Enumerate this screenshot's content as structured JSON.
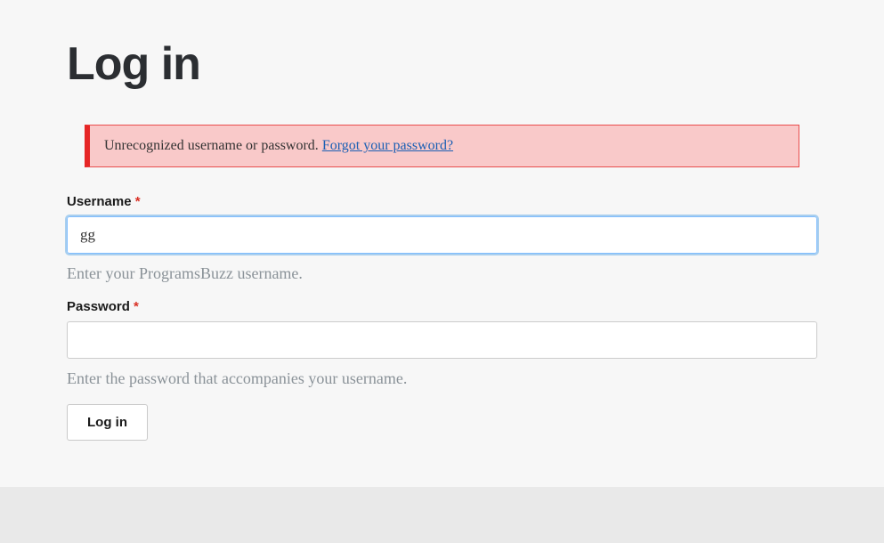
{
  "page": {
    "title": "Log in"
  },
  "alert": {
    "message": "Unrecognized username or password. ",
    "link_text": "Forgot your password?"
  },
  "form": {
    "username": {
      "label": "Username",
      "value": "gg",
      "helper": "Enter your ProgramsBuzz username."
    },
    "password": {
      "label": "Password",
      "value": "",
      "helper": "Enter the password that accompanies your username."
    },
    "required_mark": "*",
    "submit_label": "Log in"
  }
}
